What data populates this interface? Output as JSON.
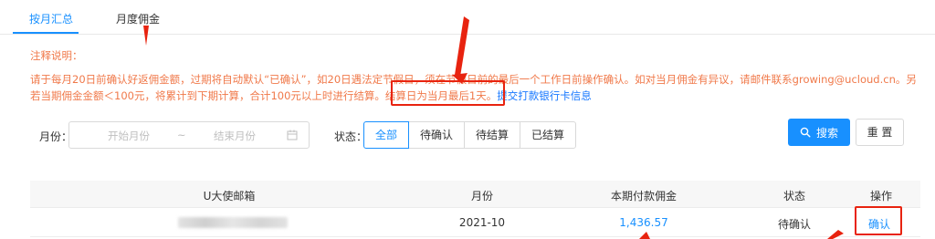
{
  "tabs": [
    {
      "label": "按月汇总",
      "active": true
    },
    {
      "label": "月度佣金",
      "active": false
    }
  ],
  "notes": {
    "title": "注释说明：",
    "body": "请于每月20日前确认好返佣金额，过期将自动默认“已确认”，如20日遇法定节假日，须在节假日前的最后一个工作日前操作确认。如对当月佣金有异议，请邮件联系growing@ucloud.cn。另若当期佣金金额＜100元，将累计到下期计算，合计100元以上时进行结算。结算日为当月最后1天。",
    "link": "提交打款银行卡信息"
  },
  "filters": {
    "month_label": "月份：",
    "start_placeholder": "开始月份",
    "separator": "~",
    "end_placeholder": "结束月份",
    "status_label": "状态：",
    "status_options": [
      "全部",
      "待确认",
      "待结算",
      "已结算"
    ],
    "status_selected": "全部",
    "search_label": "搜索",
    "reset_label": "重 置"
  },
  "table": {
    "headers": [
      "U大使邮箱",
      "月份",
      "本期付款佣金",
      "状态",
      "操作"
    ],
    "rows": [
      {
        "email": "",
        "month": "2021-10",
        "commission": "1,436.57",
        "status": "待确认",
        "action": "确认"
      }
    ]
  },
  "colors": {
    "primary": "#1890ff",
    "note": "#f0794a",
    "highlight": "#e8230f"
  }
}
